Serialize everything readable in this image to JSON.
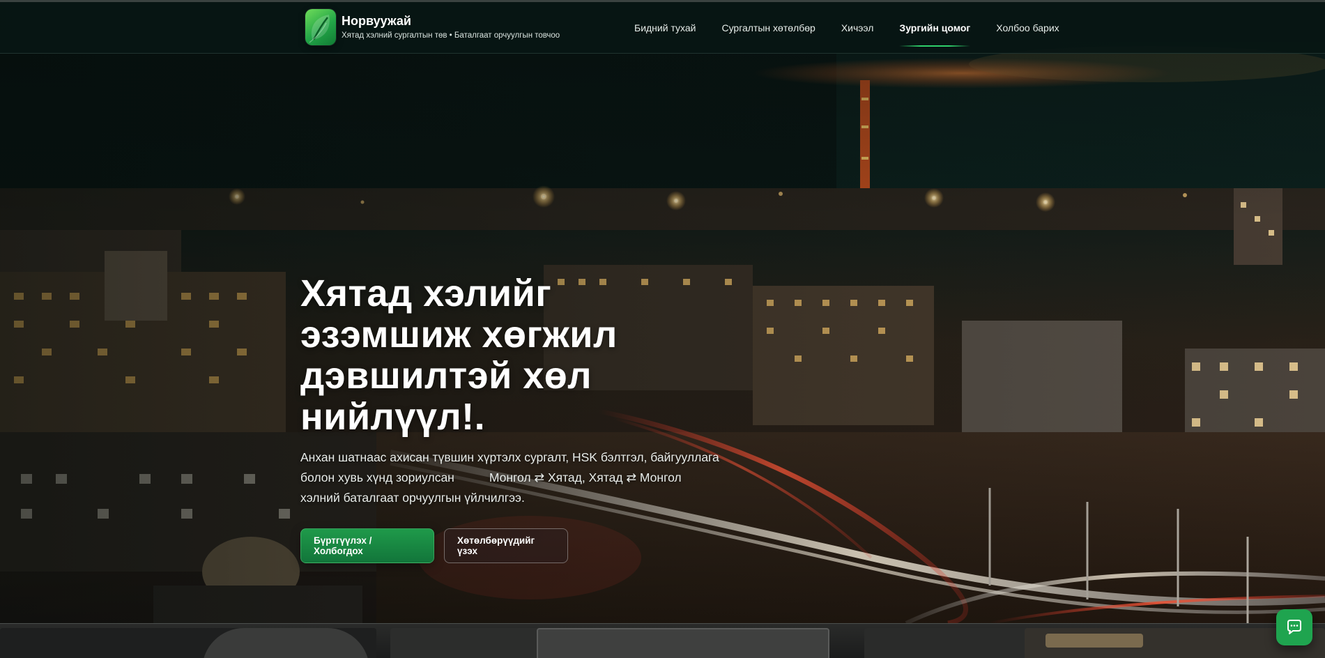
{
  "brand": {
    "name": "Норвуужай",
    "tagline": "Хятад хэлний сургалтын төв • Баталгаат орчуулгын товчоо"
  },
  "nav": {
    "items": [
      {
        "label": "Бидний тухай"
      },
      {
        "label": "Сургалтын хөтөлбөр"
      },
      {
        "label": "Хичээл"
      },
      {
        "label": "Зургийн цомог",
        "active": true
      },
      {
        "label": "Холбоо барих"
      }
    ]
  },
  "hero": {
    "title": "Хятад хэлийг эзэмшиж хөгжил дэвшилтэй хөл нийлүүл!.",
    "lead_line1": "Анхан шатнаас ахисан түвшин хүртэлх сургалт, HSK бэлтгэл, байгууллага",
    "lead_line2a": "болон хувь хүнд зориулсан",
    "lead_line2b": "Монгол ⇄ Хятад, Хятад ⇄ Монгол",
    "lead_line3": "хэлний баталгаат орчуулгын үйлчилгээ.",
    "primary_button": "Бүртгүүлэх / Холбогдох",
    "secondary_button": "Хөтөлбөрүүдийг үзэх"
  },
  "chat": {
    "icon": "chat-bubble-icon"
  },
  "colors": {
    "accent": "#1fa44f",
    "header_bg": "#081614",
    "text": "#ffffff"
  }
}
